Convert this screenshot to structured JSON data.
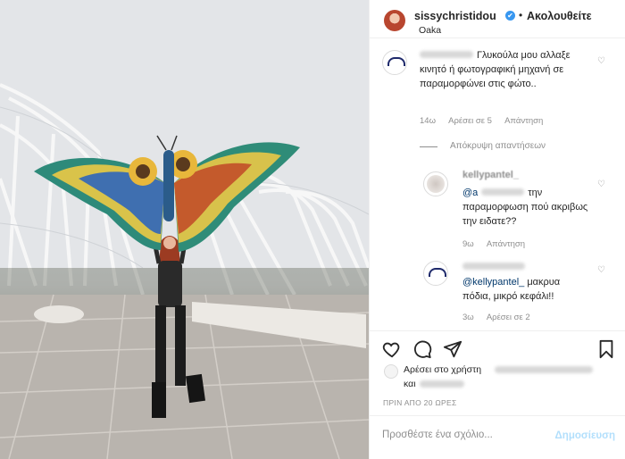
{
  "header": {
    "username": "sissychristidou",
    "follow_label": "Ακολουθείτε",
    "separator": "•",
    "location": "Oaka",
    "verified_glyph": "✔"
  },
  "comments": [
    {
      "user": "",
      "text": "Γλυκούλα μου αλλαξε κινητό ή φωτογραφική μηχανή σε παραμορφώνει στις φώτο..",
      "meta": {
        "time": "14ω",
        "likes": "Αρέσει σε 5",
        "reply": "Απάντηση"
      }
    }
  ],
  "hide_replies_label": "Απόκρυψη απαντήσεων",
  "replies": [
    {
      "user": "kellypantel_",
      "mention": "@a",
      "text": "την παραμορφωση πού ακριβως την ειδατε??",
      "meta": {
        "time": "9ω",
        "reply": "Απάντηση"
      }
    },
    {
      "user": "",
      "mention": "@kellypantel_",
      "text": "μακρυα πόδια, μικρό κεφάλι!!",
      "meta": {
        "time": "3ω",
        "likes": "Αρέσει σε 2"
      }
    }
  ],
  "likes": {
    "text": "Αρέσει στο χρήστη",
    "text2": "και"
  },
  "timestamp": "ΠΡΙΝ ΑΠΟ 20 ΩΡΕΣ",
  "add_comment": {
    "placeholder": "Προσθέστε ένα σχόλιο...",
    "post_label": "Δημοσίευση"
  },
  "icons": {
    "like": "heart-icon",
    "comment": "comment-icon",
    "share": "share-icon",
    "save": "bookmark-icon"
  },
  "colors": {
    "verified": "#3897f0",
    "link": "#00376b",
    "muted": "#8e8e8e",
    "post_button": "#b2dffc"
  }
}
